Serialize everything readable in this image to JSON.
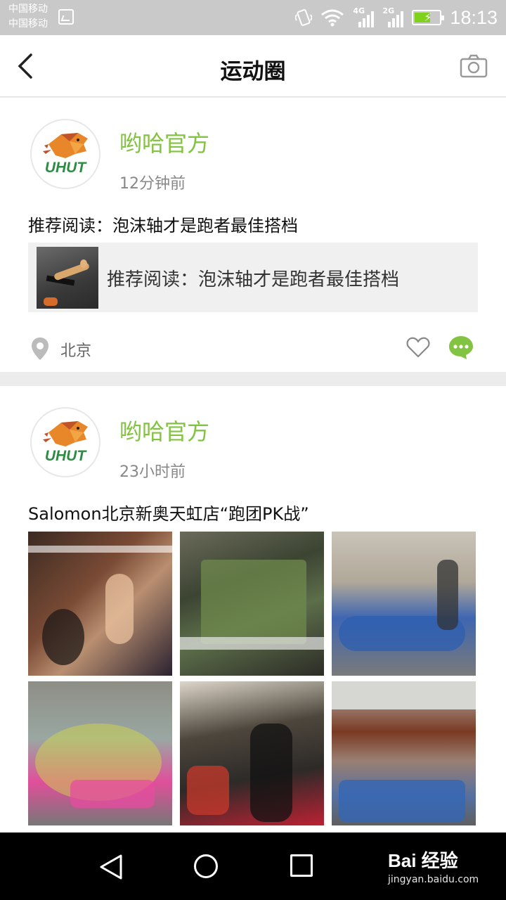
{
  "status_bar": {
    "carrier1": "中国移动",
    "carrier2": "中国移动",
    "net1": "4G",
    "net2": "2G",
    "time": "18:13"
  },
  "header": {
    "title": "运动圈"
  },
  "posts": [
    {
      "author": "哟哈官方",
      "avatar_text": "UHUT",
      "time": "12分钟前",
      "text": "推荐阅读：泡沫轴才是跑者最佳搭档",
      "link_title": "推荐阅读：泡沫轴才是跑者最佳搭档",
      "location": "北京"
    },
    {
      "author": "哟哈官方",
      "avatar_text": "UHUT",
      "time": "23小时前",
      "text": "Salomon北京新奥天虹店“跑团PK战”"
    }
  ],
  "watermark": {
    "main": "Bai 经验",
    "sub": "jingyan.baidu.com"
  },
  "colors": {
    "accent_green": "#82c341",
    "status_bar_bg": "#c9c9c9",
    "nav_bar_bg": "#000000"
  }
}
